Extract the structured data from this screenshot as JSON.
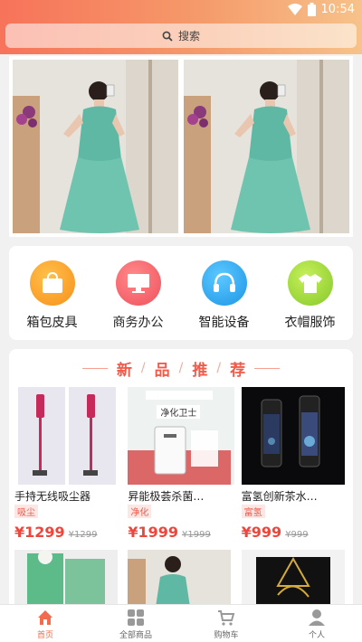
{
  "status": {
    "time": "10:54"
  },
  "search": {
    "placeholder": "搜索"
  },
  "categories": [
    {
      "label": "箱包皮具",
      "icon": "bag-icon",
      "color": "#f7a01c"
    },
    {
      "label": "商务办公",
      "icon": "monitor-icon",
      "color": "#f4606a"
    },
    {
      "label": "智能设备",
      "icon": "headphones-icon",
      "color": "#29a9ef"
    },
    {
      "label": "衣帽服饰",
      "icon": "shirt-icon",
      "color": "#9ad82f"
    }
  ],
  "recommend": {
    "title_chars": [
      "新",
      "品",
      "推",
      "荐"
    ],
    "products": [
      {
        "name": "手持无线吸尘器",
        "tag": "吸尘",
        "price": "¥1299",
        "old_price": "¥1299"
      },
      {
        "name": "昇能极荟杀菌…",
        "tag": "净化",
        "price": "¥1999",
        "old_price": "¥1999",
        "img_text": "净化卫士"
      },
      {
        "name": "富氢创新茶水…",
        "tag": "富氢",
        "price": "¥999",
        "old_price": "¥999"
      }
    ]
  },
  "tabs": [
    {
      "label": "首页",
      "icon": "home-icon",
      "active": true
    },
    {
      "label": "全部商品",
      "icon": "grid-icon",
      "active": false
    },
    {
      "label": "购物车",
      "icon": "cart-icon",
      "active": false
    },
    {
      "label": "个人",
      "icon": "person-icon",
      "active": false
    }
  ],
  "colors": {
    "accent": "#f26b4f",
    "price": "#f0453b"
  }
}
